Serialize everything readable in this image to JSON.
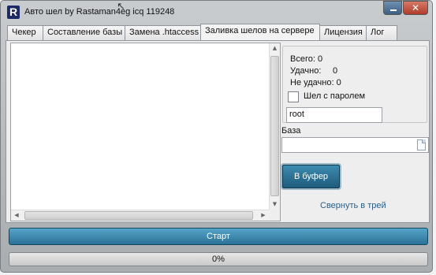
{
  "window": {
    "icon_letter": "R",
    "title": "Авто шел by Rastaman4eg icq 119248",
    "close_glyph": "✕"
  },
  "tabs": [
    {
      "label": "Чекер",
      "active": false
    },
    {
      "label": "Составление базы",
      "active": false
    },
    {
      "label": "Замена .htaccess",
      "active": false
    },
    {
      "label": "Заливка шелов на сервере",
      "active": true
    },
    {
      "label": "Лицензия",
      "active": false
    },
    {
      "label": "Лог",
      "active": false
    }
  ],
  "stats": {
    "total_label": "Всего: 0",
    "success_label": "Удачно:",
    "success_value": "0",
    "fail_label": "Не удачно: 0"
  },
  "password_checkbox": {
    "label": "Шел с паролем",
    "checked": false
  },
  "password_input": {
    "value": "root"
  },
  "base": {
    "label": "База",
    "value": ""
  },
  "buffer_button": {
    "label": "В буфер"
  },
  "tray_link": {
    "label": "Свернуть в трей"
  },
  "start_button": {
    "label": "Старт"
  },
  "progress": {
    "text": "0%",
    "value": 0
  },
  "icons": {
    "app": "app-r-icon",
    "minimize": "minimize-icon",
    "close": "close-icon",
    "file": "file-browse-icon"
  },
  "colors": {
    "accent": "#2b7296",
    "link": "#2a5f86",
    "close": "#b03b2a"
  }
}
